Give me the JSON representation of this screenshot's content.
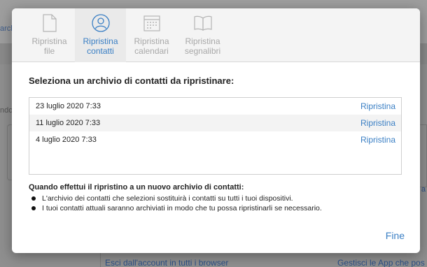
{
  "background": {
    "left_text_top": "archi",
    "left_text_mid": "ndo",
    "right_link": "a",
    "bottom_left_link": "Esci dall'account in tutti i browser",
    "bottom_right_link": "Gestisci le App che pos"
  },
  "toolbar": {
    "items": [
      {
        "label": "Ripristina\nfile",
        "icon": "file-icon",
        "active": false
      },
      {
        "label": "Ripristina\ncontatti",
        "icon": "contacts-icon",
        "active": true
      },
      {
        "label": "Ripristina\ncalendari",
        "icon": "calendar-icon",
        "active": false
      },
      {
        "label": "Ripristina\nsegnalibri",
        "icon": "bookmarks-icon",
        "active": false
      }
    ]
  },
  "main": {
    "heading": "Seleziona un archivio di contatti da ripristinare:",
    "archives": [
      {
        "date": "23 luglio 2020 7:33",
        "action": "Ripristina"
      },
      {
        "date": "11 luglio 2020 7:33",
        "action": "Ripristina"
      },
      {
        "date": "4 luglio 2020 7:33",
        "action": "Ripristina"
      }
    ],
    "info_title": "Quando effettui il ripristino a un nuovo archivio di contatti:",
    "bullets": [
      "L'archivio dei contatti che selezioni sostituirà i contatti su tutti i tuoi dispositivi.",
      "I tuoi contatti attuali saranno archiviati in modo che tu possa ripristinarli se necessario."
    ]
  },
  "footer": {
    "done_label": "Fine"
  },
  "colors": {
    "accent": "#3a7fc4",
    "inactive": "#a8a8a8"
  }
}
